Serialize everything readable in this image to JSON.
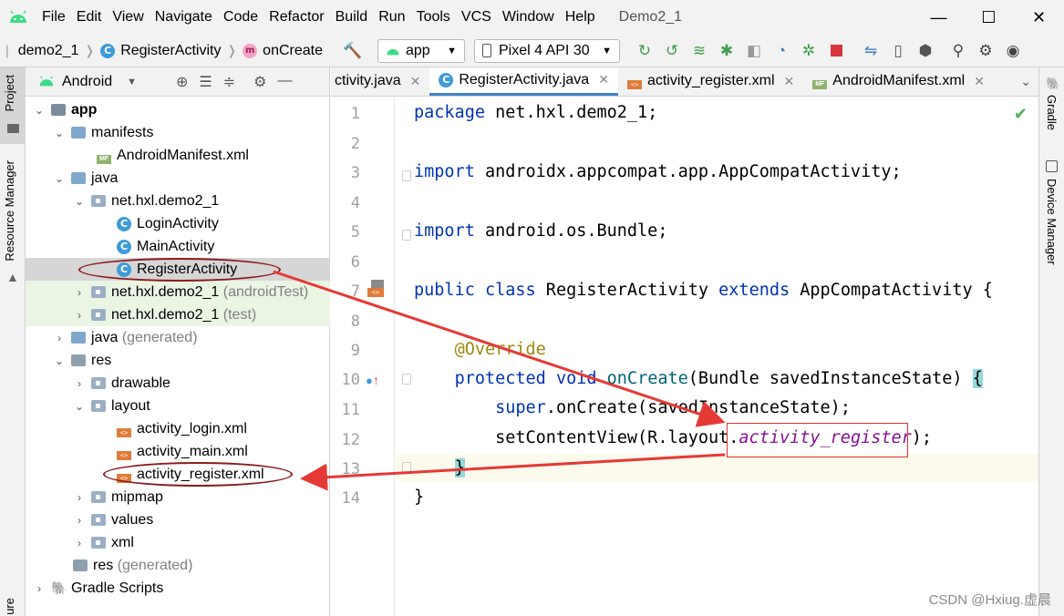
{
  "menubar": {
    "items": [
      "File",
      "Edit",
      "View",
      "Navigate",
      "Code",
      "Refactor",
      "Build",
      "Run",
      "Tools",
      "VCS",
      "Window",
      "Help"
    ],
    "project_title": "Demo2_1",
    "window_buttons": [
      "—",
      "☐",
      "✕"
    ]
  },
  "navbar": {
    "breadcrumb_project": "demo2_1",
    "breadcrumb_class": "RegisterActivity",
    "breadcrumb_method": "onCreate",
    "run_config": "app",
    "device": "Pixel 4 API 30"
  },
  "left_strip": {
    "project_tab": "Project",
    "resource_manager_tab": "Resource Manager",
    "bottom_tab": "ure"
  },
  "project_panel": {
    "view_mode": "Android",
    "tree": [
      {
        "label": "app",
        "extra": ""
      },
      {
        "label": "manifests",
        "extra": ""
      },
      {
        "label": "AndroidManifest.xml",
        "extra": ""
      },
      {
        "label": "java",
        "extra": ""
      },
      {
        "label": "net.hxl.demo2_1",
        "extra": ""
      },
      {
        "label": "LoginActivity",
        "extra": ""
      },
      {
        "label": "MainActivity",
        "extra": ""
      },
      {
        "label": "RegisterActivity",
        "extra": ""
      },
      {
        "label": "net.hxl.demo2_1",
        "extra": "(androidTest)"
      },
      {
        "label": "net.hxl.demo2_1",
        "extra": "(test)"
      },
      {
        "label": "java",
        "extra": "(generated)"
      },
      {
        "label": "res",
        "extra": ""
      },
      {
        "label": "drawable",
        "extra": ""
      },
      {
        "label": "layout",
        "extra": ""
      },
      {
        "label": "activity_login.xml",
        "extra": ""
      },
      {
        "label": "activity_main.xml",
        "extra": ""
      },
      {
        "label": "activity_register.xml",
        "extra": ""
      },
      {
        "label": "mipmap",
        "extra": ""
      },
      {
        "label": "values",
        "extra": ""
      },
      {
        "label": "xml",
        "extra": ""
      },
      {
        "label": "res",
        "extra": "(generated)"
      },
      {
        "label": "Gradle Scripts",
        "extra": ""
      }
    ]
  },
  "editor_tabs": [
    {
      "label": "ctivity.java",
      "close": "✕"
    },
    {
      "label": "RegisterActivity.java",
      "close": "✕"
    },
    {
      "label": "activity_register.xml",
      "close": "✕"
    },
    {
      "label": "AndroidManifest.xml",
      "close": "✕"
    }
  ],
  "editor": {
    "line_numbers": [
      "1",
      "2",
      "3",
      "4",
      "5",
      "6",
      "7",
      "8",
      "9",
      "10",
      "11",
      "12",
      "13",
      "14"
    ],
    "code": {
      "l1_kw": "package",
      "l1_rest": " net.hxl.demo2_1;",
      "l3_kw": "import",
      "l3_rest": " androidx.appcompat.app.AppCompatActivity;",
      "l5_kw": "import",
      "l5_rest": " android.os.Bundle;",
      "l7_kw1": "public",
      "l7_kw2": "class",
      "l7_name": " RegisterActivity ",
      "l7_kw3": "extends",
      "l7_rest": " AppCompatActivity {",
      "l9_ann": "@Override",
      "l10_kw1": "protected",
      "l10_kw2": "void",
      "l10_meth": "onCreate",
      "l10_rest": "(Bundle savedInstanceState) ",
      "l10_brace": "{",
      "l11_kw": "super",
      "l11_rest": ".onCreate(savedInstanceState);",
      "l12_a": "setContentView(R.layout.",
      "l12_field": "activity_register",
      "l12_b": ");",
      "l13_brace": "}",
      "l14": "}"
    }
  },
  "right_strip": {
    "gradle_tab": "Gradle",
    "device_manager_tab": "Device Manager"
  },
  "watermark": "CSDN @Hxiug.虚晨",
  "colors": {
    "keyword": "#0033b3",
    "annotation": "#9e880d",
    "method": "#00627a",
    "field": "#871094",
    "arrow": "#e53935",
    "ellipse": "#8b1a1a"
  }
}
